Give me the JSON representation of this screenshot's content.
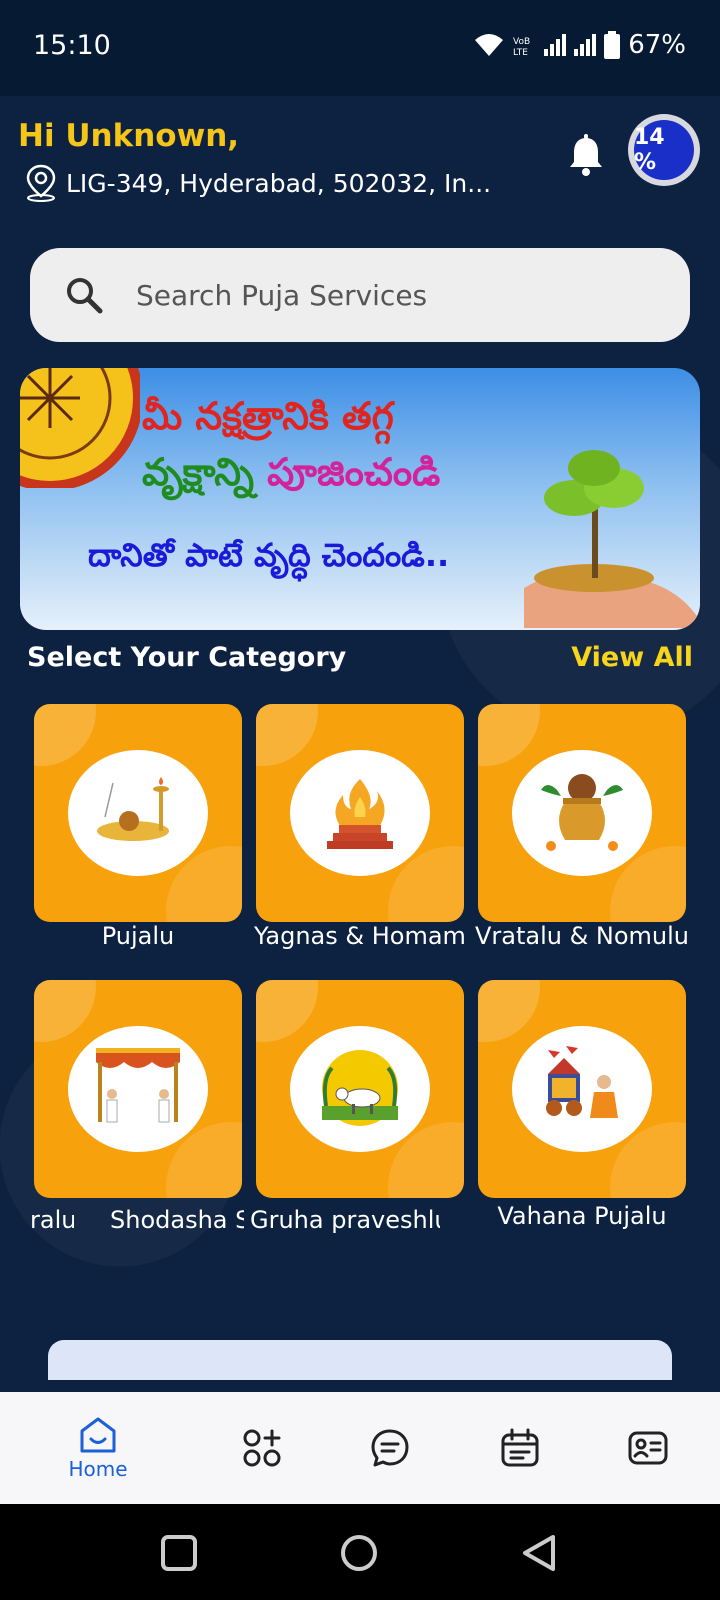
{
  "status_bar": {
    "time": "15:10",
    "network_label": "VoB LTE2",
    "battery": "67%"
  },
  "header": {
    "greeting": "Hi Unknown,",
    "location": "LIG-349, Hyderabad, 502032, In...",
    "progress_badge": "14 %"
  },
  "search": {
    "placeholder": "Search Puja Services"
  },
  "banner": {
    "line1": "మీ నక్షత్రానికి తగ్గ",
    "line2a": "వృక్షాన్ని",
    "line2b": "పూజించండి",
    "line3": "దానితో పాటే వృద్ధి చెందండి.."
  },
  "category_section": {
    "title": "Select Your Category",
    "view_all": "View All"
  },
  "categories_row1": [
    {
      "label": "Pujalu",
      "icon": "lamp-icon"
    },
    {
      "label": "Yagnas & Homam",
      "icon": "fire-icon"
    },
    {
      "label": "Vratalu & Nomulu",
      "icon": "kalash-icon"
    }
  ],
  "categories_row2": [
    {
      "label": "Vahana Pujalu",
      "icon": "chariot-icon"
    }
  ],
  "categories_row2_partial": {
    "label_a": "ralu",
    "label_b": "Shodasha S",
    "label_c": "Gruha praveshlu"
  },
  "tabbar": {
    "home": "Home"
  },
  "colors": {
    "background": "#0d2140",
    "accent_yellow": "#f5c518",
    "card_orange": "#f7a10c",
    "tab_active": "#1b5fd9"
  }
}
